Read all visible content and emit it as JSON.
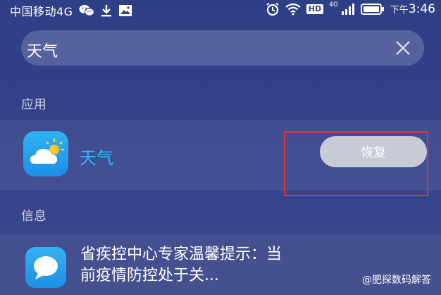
{
  "status_bar": {
    "carrier": "中国移动4G",
    "network_label": "4G",
    "hd_label": "HD",
    "time_prefix": "下午",
    "time": "3:46"
  },
  "search": {
    "query": "天气"
  },
  "sections": {
    "apps_title": "应用",
    "info_title": "信息"
  },
  "app_result": {
    "name": "天气",
    "action_label": "恢复",
    "icon": "weather-icon"
  },
  "info_result": {
    "text": "省疾控中心专家温馨提示：当前疫情防控处于关...",
    "icon": "message-icon"
  },
  "watermark": {
    "text": "@肥探数码解答"
  },
  "colors": {
    "accent_blue": "#30b6ff",
    "highlight_red": "#e0323a",
    "button_gray": "#c7cbd6"
  }
}
